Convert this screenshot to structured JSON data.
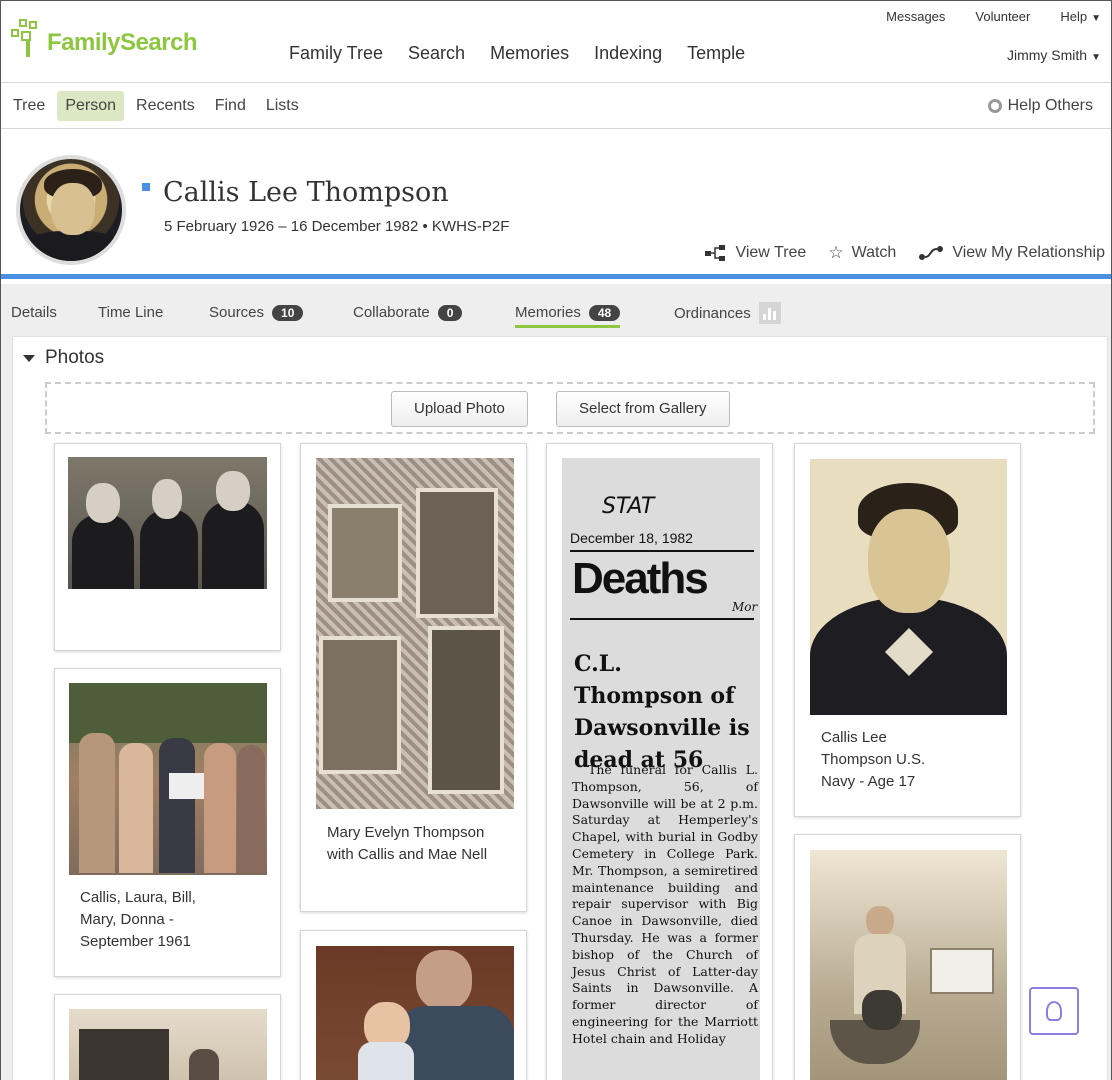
{
  "brand": {
    "name": "FamilySearch",
    "color": "#8dc63f"
  },
  "main_nav": [
    "Family Tree",
    "Search",
    "Memories",
    "Indexing",
    "Temple"
  ],
  "util_nav": {
    "messages": "Messages",
    "volunteer": "Volunteer",
    "help": "Help",
    "user": "Jimmy Smith"
  },
  "sub_nav": {
    "items": [
      "Tree",
      "Person",
      "Recents",
      "Find",
      "Lists"
    ],
    "active": "Person",
    "help_others": "Help Others"
  },
  "person": {
    "name": "Callis Lee Thompson",
    "lifespan": "5 February 1926 – 16 December 1982 • KWHS-P2F",
    "actions": {
      "view_tree": "View Tree",
      "watch": "Watch",
      "view_relationship": "View My Relationship"
    }
  },
  "tabs": {
    "details": "Details",
    "timeline": "Time Line",
    "sources": {
      "label": "Sources",
      "count": "10"
    },
    "collaborate": {
      "label": "Collaborate",
      "count": "0"
    },
    "memories": {
      "label": "Memories",
      "count": "48"
    },
    "ordinances": "Ordinances",
    "active": "Memories"
  },
  "photos": {
    "section_title": "Photos",
    "upload_label": "Upload Photo",
    "gallery_label": "Select from Gallery",
    "captions": {
      "p2": "Callis, Laura, Bill, Mary, Donna - September 1961",
      "p4": "Mary Evelyn Thompson with Callis and Mae Nell",
      "p7": "Callis Lee Thompson U.S. Navy - Age 17"
    },
    "clipping": {
      "stamp": "STAT",
      "date": "December 18, 1982",
      "masthead": "Deaths",
      "masthead_aside": "Mor",
      "headline": "C.L. Thompson of Dawsonville is dead at 56",
      "body": "The funeral for Callis L. Thompson, 56, of Dawsonville will be at 2 p.m. Saturday at Hemperley's Chapel, with burial in Godby Cemetery in College Park. Mr. Thompson, a semiretired maintenance building and repair supervisor with Big Canoe in Dawsonville, died Thursday. He was a former bishop of the Church of Jesus Christ of Latter-day Saints in Dawsonville. A former director of engineering for the Marriott Hotel chain and Holiday"
    }
  },
  "accent": "#4a90e2"
}
